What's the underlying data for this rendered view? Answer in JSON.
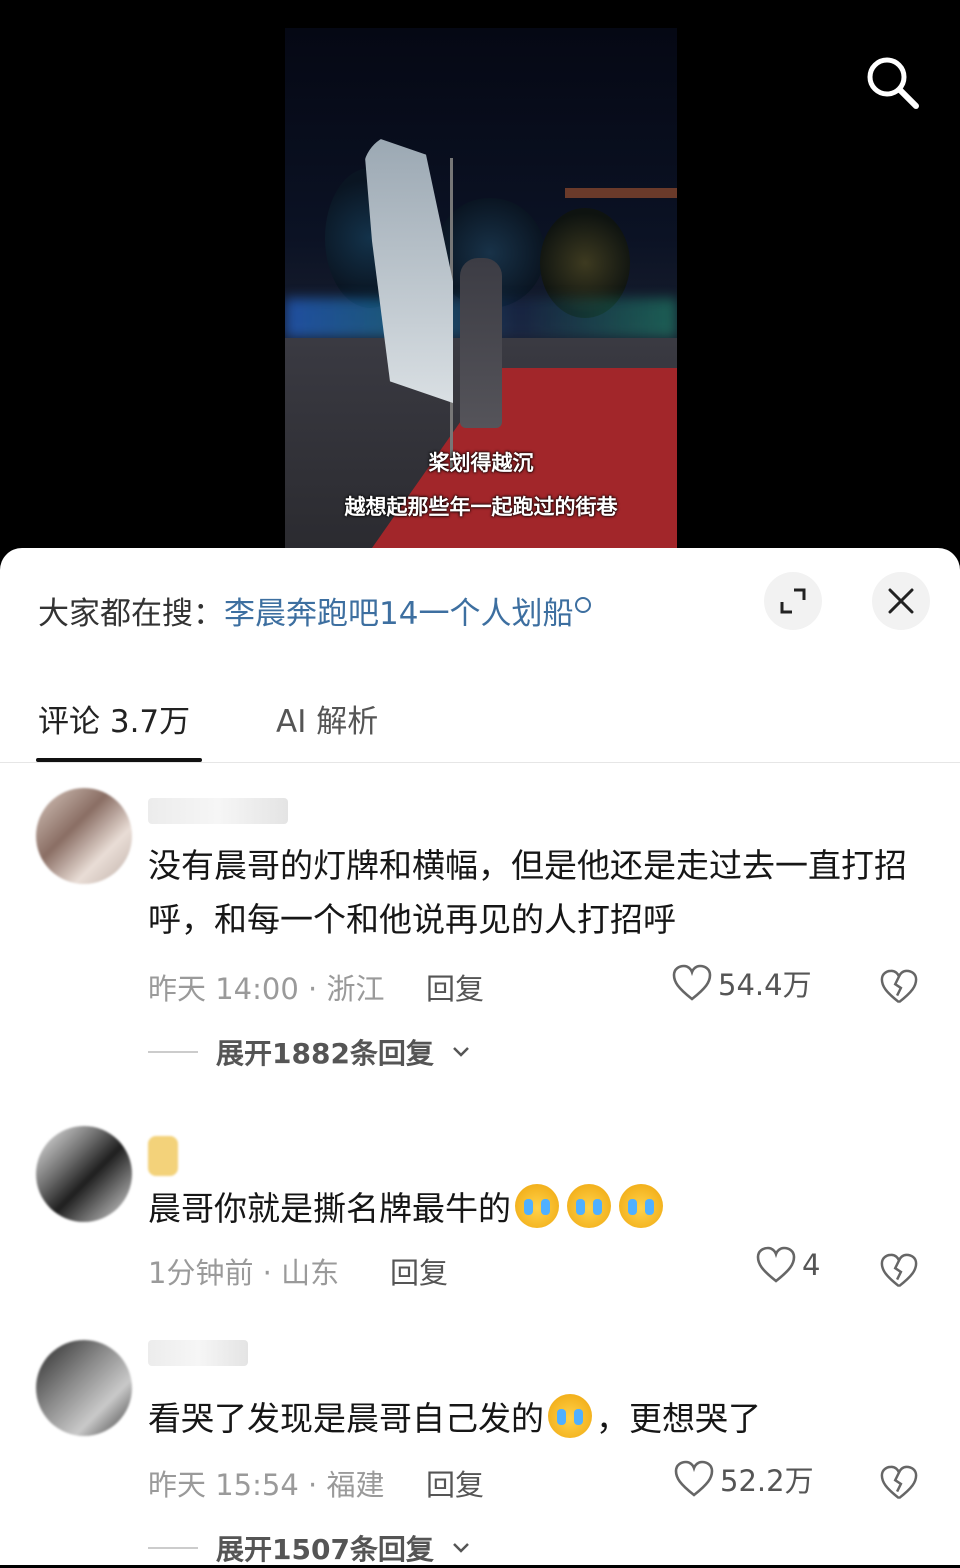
{
  "video": {
    "caption_line1": "桨划得越沉",
    "caption_line2": "越想起那些年一起跑过的街巷"
  },
  "sheet": {
    "trending_prefix": "大家都在搜：",
    "trending_query": "李晨奔跑吧14一个人划船",
    "tabs": [
      {
        "label": "评论 3.7万"
      },
      {
        "label": "AI 解析"
      }
    ]
  },
  "comments": [
    {
      "text": "没有晨哥的灯牌和横幅，但是他还是走过去一直打招呼，和每一个和他说再见的人打招呼",
      "meta": "昨天 14:00 · 浙江",
      "reply": "回复",
      "likes": "54.4万",
      "expand": "展开1882条回复"
    },
    {
      "text": "晨哥你就是撕名牌最牛的",
      "meta": "1分钟前 · 山东",
      "reply": "回复",
      "likes": "4"
    },
    {
      "text_a": "看哭了发现是晨哥自己发的",
      "text_b": "，更想哭了",
      "meta": "昨天 15:54 · 福建",
      "reply": "回复",
      "likes": "52.2万",
      "expand": "展开1507条回复"
    }
  ],
  "colors": {
    "accent_link": "#3d6fa0",
    "carpet": "#a2262a"
  }
}
